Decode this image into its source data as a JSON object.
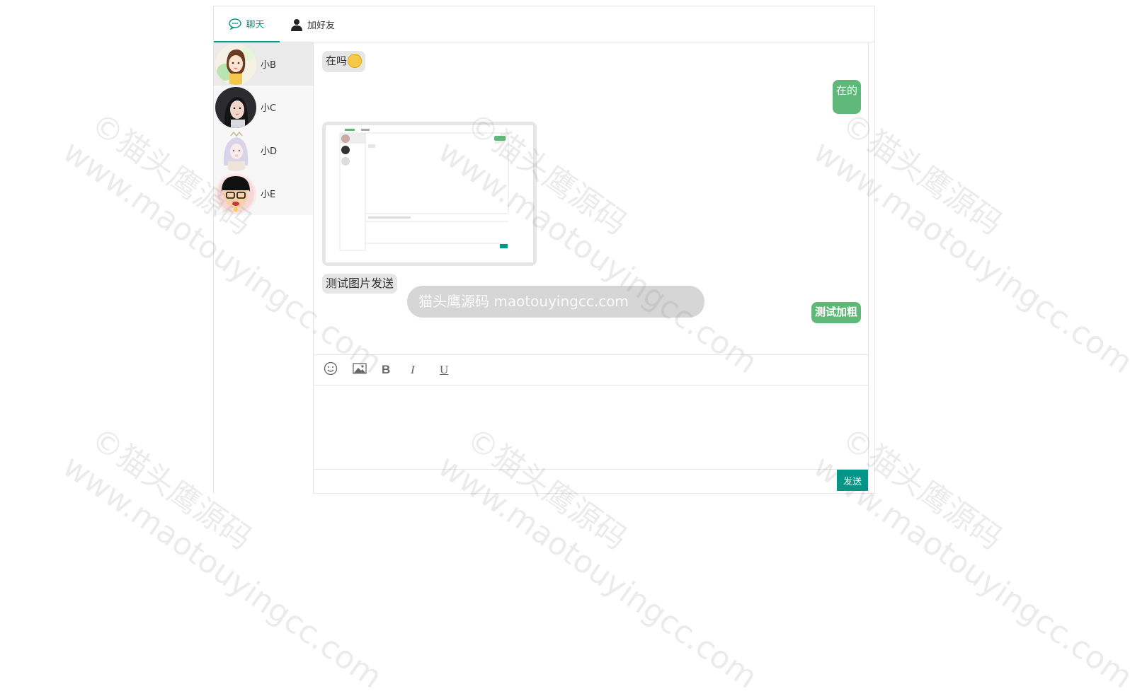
{
  "tabs": [
    {
      "label": "聊天",
      "icon": "chat-bubble-icon"
    },
    {
      "label": "加好友",
      "icon": "person-icon"
    }
  ],
  "contacts": [
    {
      "name": "小B",
      "avatar": "cartoon-girl-avatar"
    },
    {
      "name": "小C",
      "avatar": "girl-photo-avatar"
    },
    {
      "name": "小D",
      "avatar": "anime-girl-avatar"
    },
    {
      "name": "小E",
      "avatar": "cartoon-boy-avatar"
    }
  ],
  "messages": {
    "m1": "在吗",
    "m2": "在的",
    "m3": "测试图片发送",
    "m4": "测试加粗"
  },
  "toolbar": {
    "emoji": "☺",
    "image": "image-icon",
    "bold": "B",
    "italic": "I",
    "underline": "U"
  },
  "send_label": "发送",
  "ghost_text": "猫头鹰源码 maotouyingcc.com",
  "watermark": {
    "line1": "©猫头鹰源码",
    "line2": "www.maotouyingcc.com"
  },
  "colors": {
    "accent": "#009688",
    "bubble_right": "#5fb878",
    "bubble_left": "#e6e6e6"
  }
}
